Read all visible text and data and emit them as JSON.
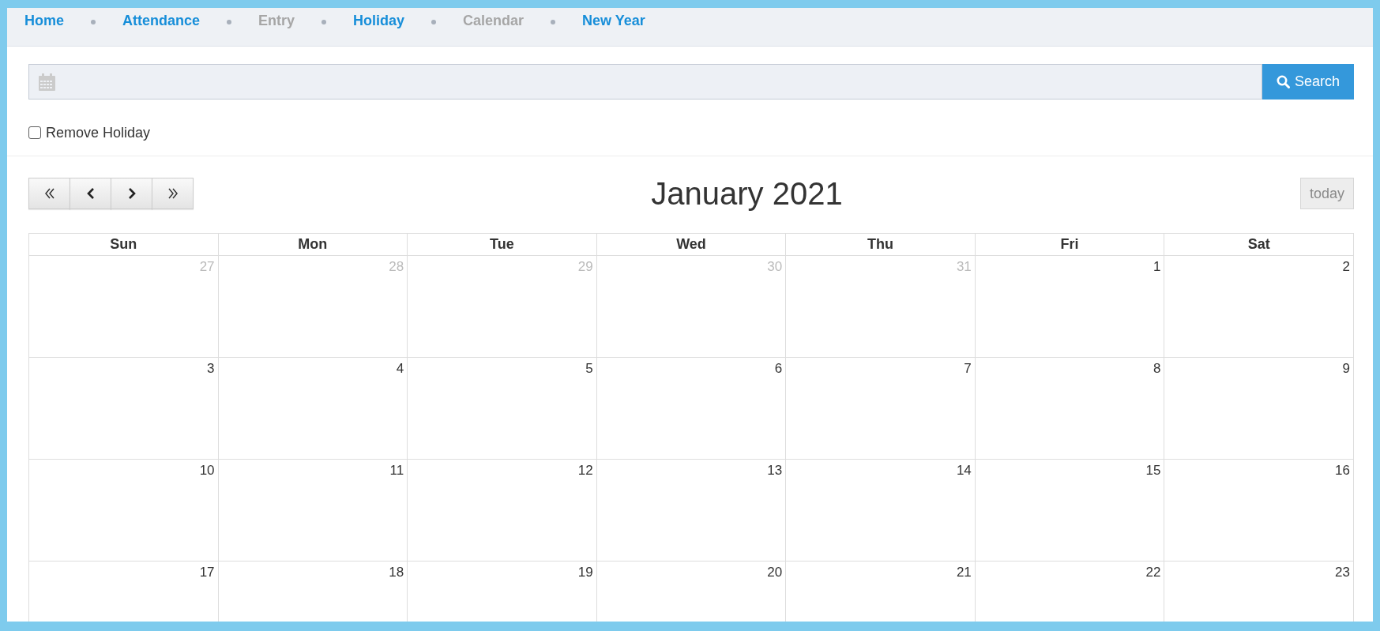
{
  "breadcrumb": [
    {
      "label": "Home",
      "disabled": false
    },
    {
      "label": "Attendance",
      "disabled": false
    },
    {
      "label": "Entry",
      "disabled": true
    },
    {
      "label": "Holiday",
      "disabled": false
    },
    {
      "label": "Calendar",
      "disabled": true
    },
    {
      "label": "New Year",
      "disabled": false
    }
  ],
  "search": {
    "button_label": "Search"
  },
  "remove_holiday": {
    "label": "Remove Holiday",
    "checked": false
  },
  "calendar": {
    "title": "January 2021",
    "nav_buttons": [
      {
        "kind": "prev-year"
      },
      {
        "kind": "prev"
      },
      {
        "kind": "next"
      },
      {
        "kind": "next-year"
      }
    ],
    "today_button": {
      "label": "today",
      "disabled": true
    },
    "weekdays": [
      "Sun",
      "Mon",
      "Tue",
      "Wed",
      "Thu",
      "Fri",
      "Sat"
    ],
    "weeks": [
      [
        {
          "day": "27",
          "other_month": true
        },
        {
          "day": "28",
          "other_month": true
        },
        {
          "day": "29",
          "other_month": true
        },
        {
          "day": "30",
          "other_month": true
        },
        {
          "day": "31",
          "other_month": true
        },
        {
          "day": "1",
          "other_month": false
        },
        {
          "day": "2",
          "other_month": false
        }
      ],
      [
        {
          "day": "3",
          "other_month": false
        },
        {
          "day": "4",
          "other_month": false
        },
        {
          "day": "5",
          "other_month": false
        },
        {
          "day": "6",
          "other_month": false
        },
        {
          "day": "7",
          "other_month": false
        },
        {
          "day": "8",
          "other_month": false
        },
        {
          "day": "9",
          "other_month": false
        }
      ],
      [
        {
          "day": "10",
          "other_month": false
        },
        {
          "day": "11",
          "other_month": false
        },
        {
          "day": "12",
          "other_month": false
        },
        {
          "day": "13",
          "other_month": false
        },
        {
          "day": "14",
          "other_month": false
        },
        {
          "day": "15",
          "other_month": false
        },
        {
          "day": "16",
          "other_month": false
        }
      ],
      [
        {
          "day": "17",
          "other_month": false
        },
        {
          "day": "18",
          "other_month": false
        },
        {
          "day": "19",
          "other_month": false
        },
        {
          "day": "20",
          "other_month": false
        },
        {
          "day": "21",
          "other_month": false
        },
        {
          "day": "22",
          "other_month": false
        },
        {
          "day": "23",
          "other_month": false
        }
      ]
    ]
  }
}
